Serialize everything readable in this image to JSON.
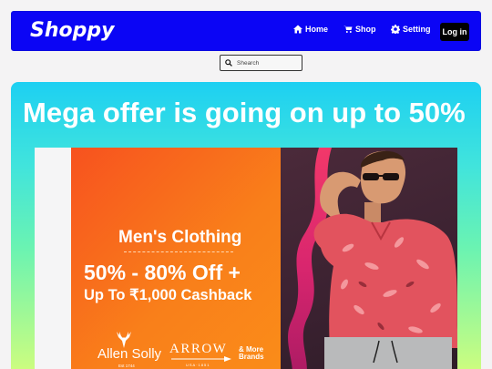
{
  "navbar": {
    "brand": "Shoppy",
    "links": [
      {
        "label": "Home",
        "icon": "home-icon"
      },
      {
        "label": "Shop",
        "icon": "cart-icon"
      },
      {
        "label": "Setting",
        "icon": "gear-icon"
      }
    ],
    "login_label": "Log in",
    "bg_color": "#0b05f5"
  },
  "search": {
    "placeholder": "Shearch",
    "icon": "search-icon"
  },
  "hero": {
    "title": "Mega offer is going on up to 50%",
    "banner": {
      "heading": "Men's Clothing",
      "discount": "50% - 80% Off +",
      "cashback": "Up To ₹1,000 Cashback",
      "brands": {
        "allen_solly": "Allen Solly",
        "allen_solly_est": "Est 1744",
        "arrow": "ARROW",
        "arrow_sub": "USA·1851",
        "more": "& More Brands"
      }
    }
  }
}
